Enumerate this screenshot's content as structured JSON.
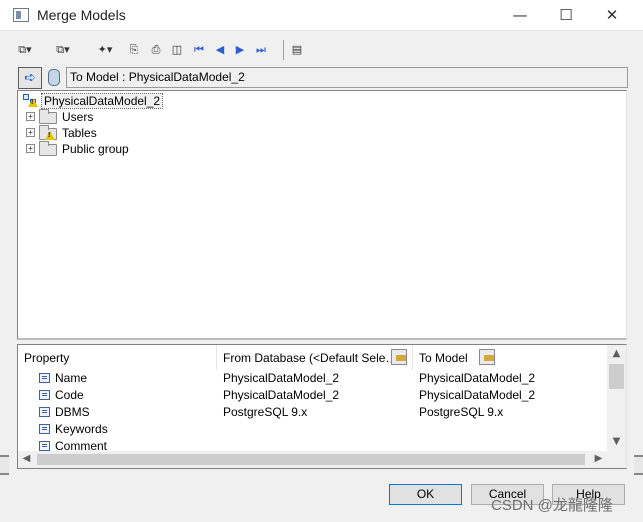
{
  "window": {
    "title": "Merge Models",
    "controls": {
      "minimize": "—",
      "maximize": "☐",
      "close": "✕"
    }
  },
  "toolbar": {
    "items": [
      {
        "name": "merge-options-dropdown",
        "glyph": "⧉▾"
      },
      {
        "name": "filter-dropdown",
        "glyph": "⧉▾"
      },
      {
        "name": "action-dropdown",
        "glyph": "✦▾"
      },
      {
        "name": "properties-icon",
        "glyph": "⎘"
      },
      {
        "name": "find-icon",
        "glyph": "⎙"
      },
      {
        "name": "compare-icon",
        "glyph": "◫"
      },
      {
        "name": "first-icon",
        "glyph": "⏮"
      },
      {
        "name": "previous-icon",
        "glyph": "◀"
      },
      {
        "name": "next-icon",
        "glyph": "▶"
      },
      {
        "name": "last-icon",
        "glyph": "⏭"
      },
      {
        "name": "report-icon",
        "glyph": "▤"
      }
    ]
  },
  "target": {
    "direction_glyph": "➪",
    "label": "To Model : PhysicalDataModel_2"
  },
  "tree": {
    "root": "PhysicalDataModel_2",
    "expander_glyph": "+",
    "children": [
      {
        "label": "Users",
        "warning": false
      },
      {
        "label": "Tables",
        "warning": true
      },
      {
        "label": "Public group",
        "warning": false
      }
    ]
  },
  "properties": {
    "headers": [
      "Property",
      "From Database (<Default Sele…",
      "To Model"
    ],
    "rows": [
      {
        "property": "Name",
        "from": "PhysicalDataModel_2",
        "to": "PhysicalDataModel_2"
      },
      {
        "property": "Code",
        "from": "PhysicalDataModel_2",
        "to": "PhysicalDataModel_2"
      },
      {
        "property": "DBMS",
        "from": "PostgreSQL 9.x",
        "to": "PostgreSQL 9.x"
      },
      {
        "property": "Keywords",
        "from": "",
        "to": ""
      },
      {
        "property": "Comment",
        "from": "",
        "to": ""
      }
    ],
    "scroll_glyphs": {
      "up": "▲",
      "down": "▼",
      "left": "◀",
      "right": "▶"
    }
  },
  "buttons": {
    "ok": "OK",
    "cancel": "Cancel",
    "help": "Help"
  },
  "watermark": "CSDN @龙龍隆隆"
}
